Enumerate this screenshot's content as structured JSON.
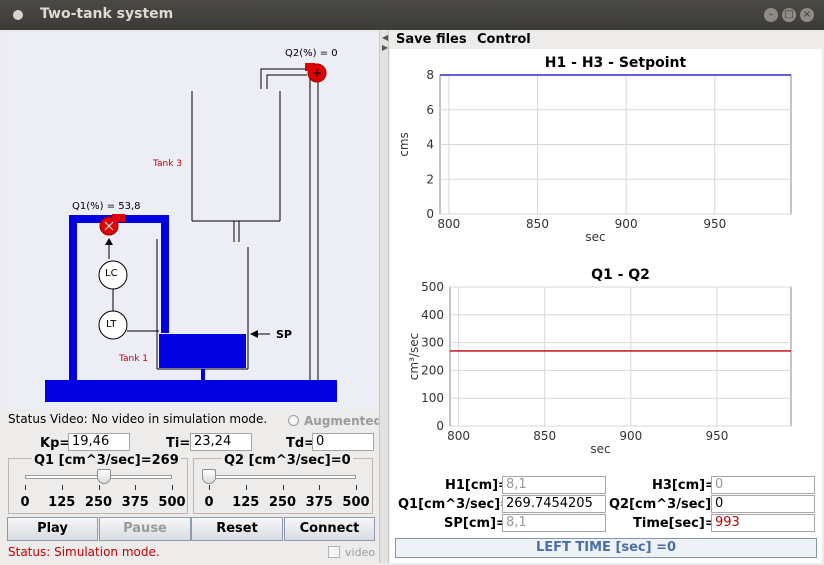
{
  "window": {
    "title": "Two-tank system"
  },
  "menu": {
    "save_files": "Save files",
    "control": "Control"
  },
  "simulation": {
    "q2_label": "Q2(%) = 0",
    "q1_label": "Q1(%) = 53,8",
    "tank3_label": "Tank 3",
    "tank1_label": "Tank 1",
    "lc": "LC",
    "lt": "LT",
    "sp": "SP"
  },
  "status_video": "Status Video: No video in simulation mode.",
  "augmented_label": "Augmented",
  "pid": {
    "kp_label": "Kp=",
    "kp_value": "19,46",
    "ti_label": "Ti=",
    "ti_value": "23,24",
    "td_label": "Td=",
    "td_value": "0"
  },
  "sliders": {
    "q1_label": "Q1 [cm^3/sec]=269",
    "q1_fraction": 0.538,
    "q2_label": "Q2 [cm^3/sec]=0",
    "q2_fraction": 0,
    "ticks": [
      "0",
      "125",
      "250",
      "375",
      "500"
    ]
  },
  "buttons": {
    "play": "Play",
    "pause": "Pause",
    "reset": "Reset",
    "connect": "Connect"
  },
  "status": "Status: Simulation mode.",
  "video_label": "video",
  "readouts": {
    "h1_label": "H1[cm]=",
    "h1_value": "8,1",
    "h3_label": "H3[cm]=",
    "h3_value": "0",
    "q1_label": "Q1[cm^3/sec]=",
    "q1_value": "269.7454205",
    "q2_label": "Q2[cm^3/sec]=",
    "q2_value": "0",
    "sp_label": "SP[cm]=",
    "sp_value": "8,1",
    "time_label": "Time[sec]=",
    "time_value": "993"
  },
  "left_time": "LEFT TIME [sec] =0",
  "chart_data": [
    {
      "type": "line",
      "title": "H1 - H3 - Setpoint",
      "xlabel": "sec",
      "ylabel": "cms",
      "xlim": [
        795,
        993
      ],
      "ylim": [
        0,
        8
      ],
      "xticks": [
        "800",
        "850",
        "900",
        "950"
      ],
      "yticks": [
        "0",
        "2",
        "4",
        "6",
        "8"
      ],
      "grid": true,
      "series": [
        {
          "color": "#0000c8",
          "x": [
            795,
            993
          ],
          "y": [
            8,
            8
          ]
        }
      ]
    },
    {
      "type": "line",
      "title": "Q1 - Q2",
      "xlabel": "sec",
      "ylabel": "cm³/sec",
      "xlim": [
        795,
        993
      ],
      "ylim": [
        0,
        500
      ],
      "xticks": [
        "800",
        "850",
        "900",
        "950"
      ],
      "yticks": [
        "0",
        "100",
        "200",
        "300",
        "400",
        "500"
      ],
      "grid": true,
      "series": [
        {
          "color": "#c00000",
          "x": [
            795,
            993
          ],
          "y": [
            270,
            270
          ]
        }
      ]
    }
  ]
}
